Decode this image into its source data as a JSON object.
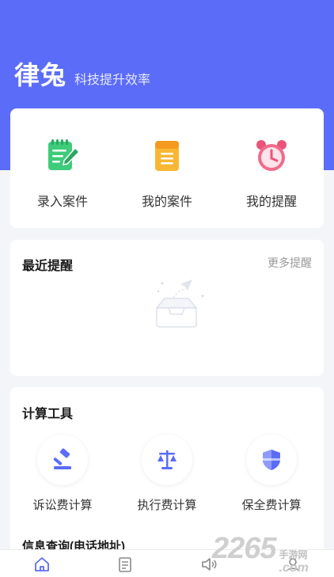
{
  "header": {
    "brand_name": "律兔",
    "slogan": "科技提升效率",
    "background_color": "#5b6cf9"
  },
  "quick_actions": [
    {
      "label": "录入案件",
      "icon": "notepad-pencil-icon",
      "color": "#3ecb7a"
    },
    {
      "label": "我的案件",
      "icon": "folder-document-icon",
      "color": "#f7b733"
    },
    {
      "label": "我的提醒",
      "icon": "alarm-clock-icon",
      "color": "#f06b8a"
    }
  ],
  "reminders": {
    "title": "最近提醒",
    "more_label": "更多提醒",
    "empty_icon": "empty-inbox-icon"
  },
  "tools": {
    "title": "计算工具",
    "items": [
      {
        "label": "诉讼费计算",
        "icon": "gavel-icon"
      },
      {
        "label": "执行费计算",
        "icon": "scales-icon"
      },
      {
        "label": "保全费计算",
        "icon": "shield-icon"
      }
    ],
    "accent_color": "#5b6cf9"
  },
  "info_query": {
    "title": "信息查询(电话地址)"
  },
  "tabbar": {
    "items": [
      {
        "name": "home",
        "icon": "home-icon",
        "active": true
      },
      {
        "name": "cases",
        "icon": "document-list-icon",
        "active": false
      },
      {
        "name": "notice",
        "icon": "speaker-icon",
        "active": false
      },
      {
        "name": "profile",
        "icon": "user-icon",
        "active": false
      }
    ],
    "active_color": "#5b6cf9"
  },
  "watermark": {
    "number": "2265",
    "site_cn": "手游网",
    "domain": ".com"
  }
}
